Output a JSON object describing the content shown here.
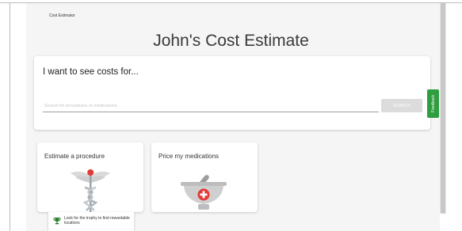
{
  "breadcrumb": {
    "label": "Cost Estimator"
  },
  "page": {
    "title": "John's Cost Estimate"
  },
  "search": {
    "heading": "I want to see costs for...",
    "placeholder": "Search for procedures or medications",
    "value": "",
    "button_label": "SEARCH"
  },
  "feedback": {
    "label": "Feedback"
  },
  "cards": {
    "procedure": {
      "title": "Estimate a procedure",
      "icon": "caduceus-icon"
    },
    "medications": {
      "title": "Price my medications",
      "icon": "mortar-pestle-icon"
    }
  },
  "tooltip": {
    "text": "Look for the trophy to find rewardable locations",
    "icon": "trophy-icon"
  },
  "colors": {
    "feedback": "#2e9e3e",
    "accent_red": "#e53935",
    "panel": "#f5f5f5"
  }
}
